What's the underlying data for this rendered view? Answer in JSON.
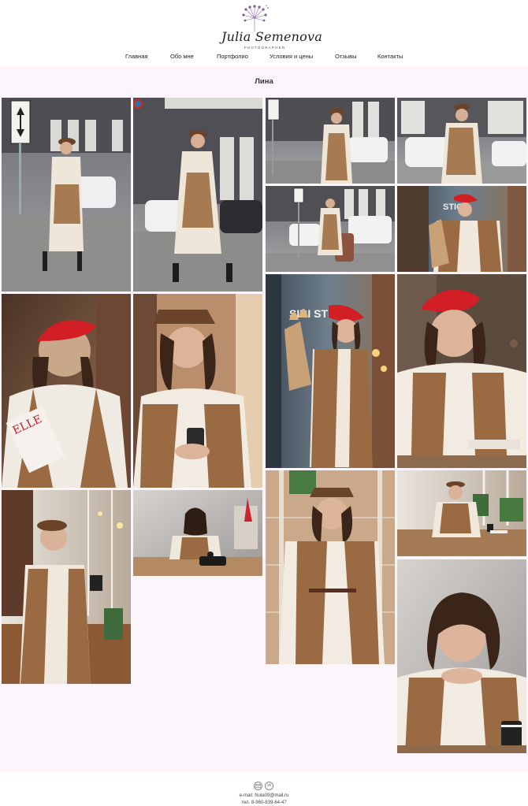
{
  "header": {
    "logo": {
      "name": "Julia Semenova",
      "subtitle": "PHOTOGRAPHER"
    },
    "nav": [
      {
        "label": "Главная"
      },
      {
        "label": "Обо мне"
      },
      {
        "label": "Портфолио"
      },
      {
        "label": "Условия и цены"
      },
      {
        "label": "Отзывы"
      },
      {
        "label": "Контакты"
      }
    ]
  },
  "main": {
    "title": "Лина",
    "photo_signs": {
      "cafe_sign": "SIBI  STICA",
      "cafe_sign_small": "STICA"
    }
  },
  "footer": {
    "email_icon": "email-icon",
    "vk_icon": "vk-icon",
    "vk_text": "vk",
    "email": "e-mail: Nula09@mail.ru",
    "phone": "тел. 8-960-839-64-47"
  },
  "colors": {
    "band": "#fcf6fc",
    "beret_red": "#d21f26",
    "vest_brown": "#9a6a43"
  }
}
